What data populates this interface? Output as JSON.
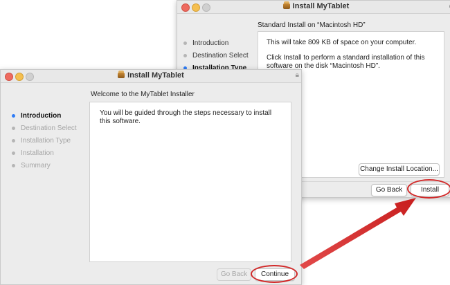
{
  "back_window": {
    "title": "Install MyTablet",
    "heading": "Standard Install on “Macintosh HD”",
    "steps": [
      {
        "label": "Introduction",
        "state": "past"
      },
      {
        "label": "Destination Select",
        "state": "past"
      },
      {
        "label": "Installation Type",
        "state": "current"
      }
    ],
    "content_line1": "This will take 809 KB of space on your computer.",
    "content_line2": "Click Install to perform a standard installation of this software on the disk “Macintosh HD”.",
    "change_location_label": "Change Install Location...",
    "go_back_label": "Go Back",
    "install_label": "Install"
  },
  "front_window": {
    "title": "Install MyTablet",
    "heading": "Welcome to the MyTablet Installer",
    "steps": [
      {
        "label": "Introduction",
        "state": "current"
      },
      {
        "label": "Destination Select",
        "state": "future"
      },
      {
        "label": "Installation Type",
        "state": "future"
      },
      {
        "label": "Installation",
        "state": "future"
      },
      {
        "label": "Summary",
        "state": "future"
      }
    ],
    "content_text": "You will be guided through the steps necessary to install this software.",
    "go_back_label": "Go Back",
    "continue_label": "Continue"
  },
  "colors": {
    "annotation": "#d22a2a",
    "current_step": "#2f7cf6"
  }
}
